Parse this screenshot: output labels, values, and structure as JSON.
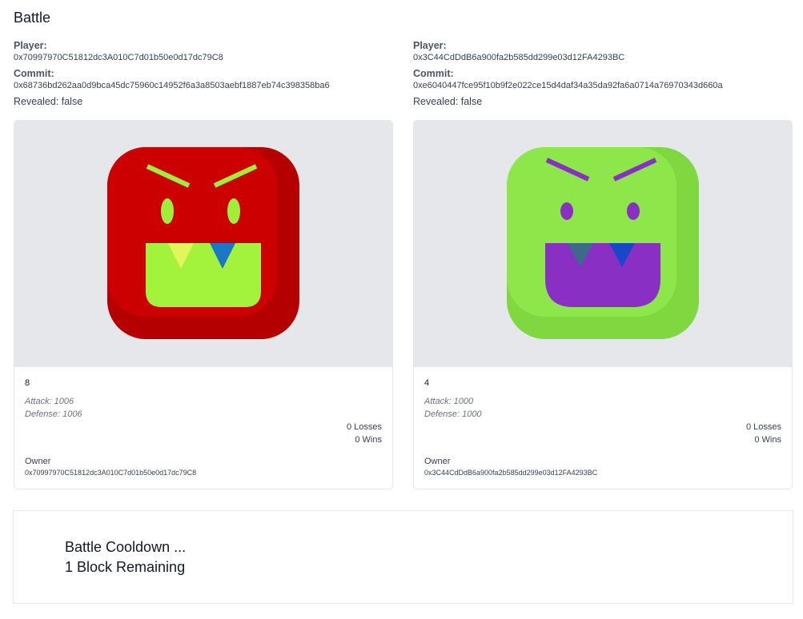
{
  "page": {
    "title": "Battle"
  },
  "players": [
    {
      "player_label": "Player:",
      "player_address": "0x70997970C51812dc3A010C7d01b50e0d17dc79C8",
      "commit_label": "Commit:",
      "commit_hash": "0x68736bd262aa0d9bca45dc75960c14952f6a3a8503aebf1887eb74c398358ba6",
      "revealed_text": "Revealed: false",
      "card": {
        "id": "8",
        "attack": "Attack: 1006",
        "defense": "Defense: 1006",
        "losses": "0 Losses",
        "wins": "0 Wins",
        "owner_label": "Owner",
        "owner_address": "0x70997970C51812dc3A010C7d01b50e0d17dc79C8",
        "colors": {
          "face": "#cc0000",
          "face_shadow": "#b50000",
          "features": "#9eef3c",
          "mouth": "#a3f23c",
          "tooth_left": "#e2f55c",
          "tooth_right": "#1b78c8"
        }
      }
    },
    {
      "player_label": "Player:",
      "player_address": "0x3C44CdDdB6a900fa2b585dd299e03d12FA4293BC",
      "commit_label": "Commit:",
      "commit_hash": "0xe6040447fce95f10b9f2e022ce15d4daf34a35da92fa6a0714a76970343d660a",
      "revealed_text": "Revealed: false",
      "card": {
        "id": "4",
        "attack": "Attack: 1000",
        "defense": "Defense: 1000",
        "losses": "0 Losses",
        "wins": "0 Wins",
        "owner_label": "Owner",
        "owner_address": "0x3C44CdDdB6a900fa2b585dd299e03d12FA4293BC",
        "colors": {
          "face": "#8de64a",
          "face_shadow": "#7fd840",
          "features": "#8a2fc4",
          "mouth": "#8a2fc4",
          "tooth_left": "#3c6a88",
          "tooth_right": "#1848c8"
        }
      }
    }
  ],
  "cooldown": {
    "line1": "Battle Cooldown ...",
    "line2": "1 Block Remaining"
  }
}
